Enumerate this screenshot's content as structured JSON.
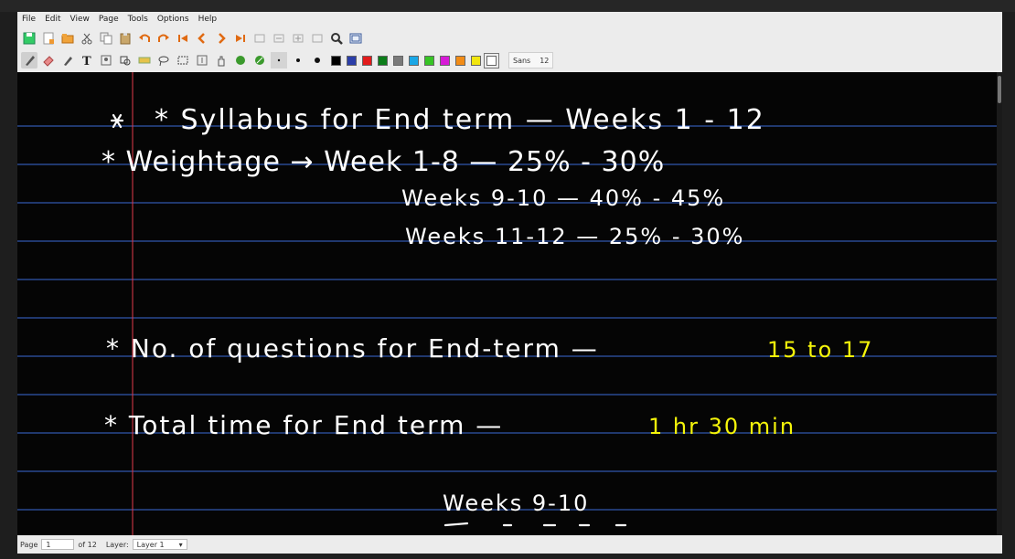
{
  "menu": [
    "File",
    "Edit",
    "View",
    "Page",
    "Tools",
    "Options",
    "Help"
  ],
  "toolbar": {
    "icons": [
      "save-icon",
      "new-page-icon",
      "open-icon",
      "cut-icon",
      "copy-icon",
      "paste-icon",
      "undo-icon",
      "redo-icon",
      "first-page-icon",
      "prev-page-icon",
      "next-page-icon",
      "last-page-icon",
      "zoom-fit-icon",
      "zoom-out-icon",
      "zoom-in-icon",
      "zoom-page-icon",
      "search-icon",
      "fullscreen-icon"
    ],
    "colors": [
      "#000000",
      "#2b3ea8",
      "#e21b1b",
      "#0c7d1a",
      "#7a7a7a",
      "#1aa7e6",
      "#37c425",
      "#d61ad6",
      "#f28c17",
      "#f2e60f",
      "#ffffff"
    ],
    "selected_color": "#ffffff",
    "font_name": "Sans",
    "font_size": "12"
  },
  "notes": {
    "line1": "* Syllabus for End term — Weeks 1 - 12",
    "line2a": "* Weightage → Week 1-8 — 25% - 30%",
    "line2b": "Weeks 9-10 — 40% - 45%",
    "line2c": "Weeks 11-12 — 25% - 30%",
    "line3": "* No. of questions for End-term —",
    "line3_value": "15 to 17",
    "line4": "* Total time for End term —",
    "line4_value": "1 hr 30 min",
    "line5": "Weeks 9-10",
    "highlight_color": "#f5f50a",
    "ink_color": "#ffffff",
    "rule_color": "#3a6bd6",
    "margin_color": "#e23a4a"
  },
  "status": {
    "page_label": "Page",
    "page_value": "1",
    "of_label": "of 12",
    "layer_label": "Layer:",
    "layer_value": "Layer 1"
  }
}
